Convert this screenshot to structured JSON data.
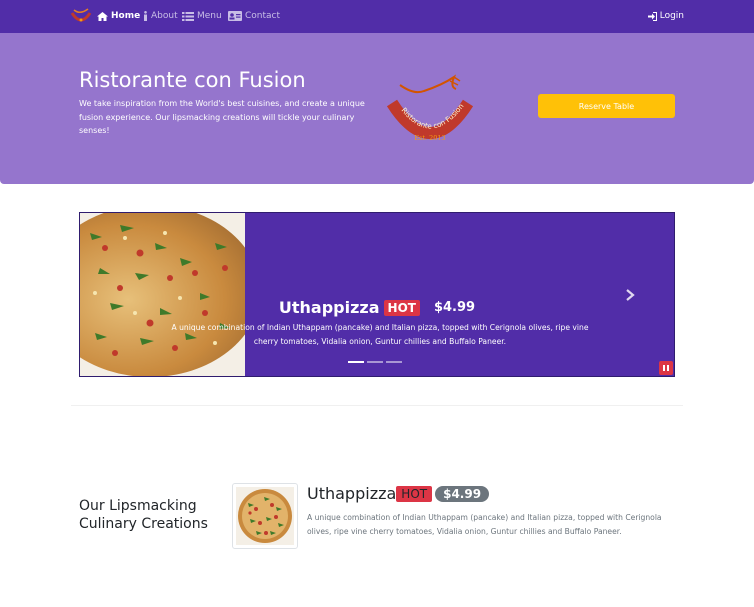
{
  "navbar": {
    "brand_icon": "ristorante-logo-icon",
    "items": [
      {
        "label": "Home",
        "icon": "home-icon",
        "active": true
      },
      {
        "label": "About",
        "icon": "info-icon",
        "active": false
      },
      {
        "label": "Menu",
        "icon": "list-icon",
        "active": false
      },
      {
        "label": "Contact",
        "icon": "address-card-icon",
        "active": false
      }
    ],
    "login_label": "Login",
    "login_icon": "sign-in-icon"
  },
  "jumbotron": {
    "title": "Ristorante con Fusion",
    "text": "We take inspiration from the World's best cuisines, and create a unique fusion experience. Our lipsmacking creations will tickle your culinary senses!",
    "logo_text": "Ristorante con Fusion",
    "logo_est": "Est. 2013",
    "reserve_label": "Reserve Table"
  },
  "carousel": {
    "dish_name": "Uthappizza",
    "badge": "HOT",
    "price": "$4.99",
    "description": "A unique combination of Indian Uthappam (pancake) and Italian pizza, topped with Cerignola olives, ripe vine cherry tomatoes, Vidalia onion, Guntur chillies and Buffalo Paneer.",
    "indicators": 3,
    "active_indicator": 0
  },
  "featured": {
    "section_title": "Our Lipsmacking Culinary Creations",
    "dish_name": "Uthappizza",
    "badge": "HOT",
    "price": "$4.99",
    "description": "A unique combination of Indian Uthappam (pancake) and Italian pizza, topped with Cerignola olives, ripe vine cherry tomatoes, Vidalia onion, Guntur chillies and Buffalo Paneer."
  },
  "colors": {
    "primary": "#512da8",
    "primary_light": "#9575cd",
    "warning": "#ffc107",
    "danger": "#dc3545",
    "secondary": "#6c757d"
  }
}
